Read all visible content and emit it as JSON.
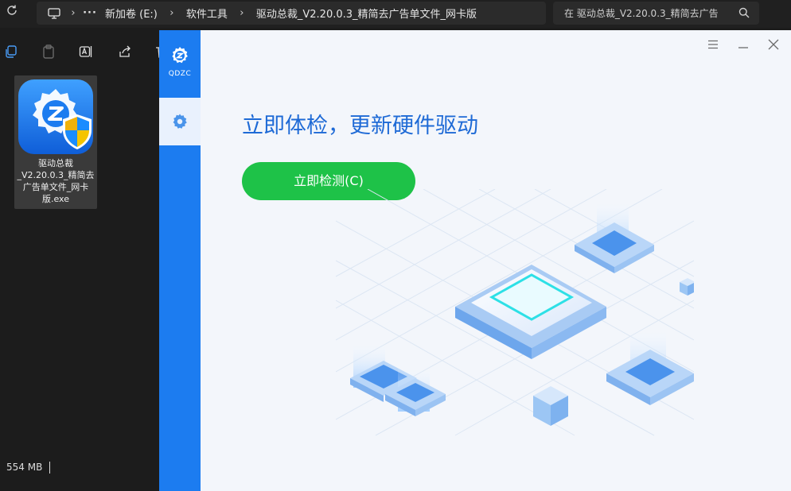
{
  "explorer": {
    "breadcrumbs": [
      "新加卷 (E:)",
      "软件工具",
      "驱动总裁_V2.20.0.3_精简去广告单文件_网卡版"
    ],
    "more_label": "···",
    "search_placeholder": "在 驱动总裁_V2.20.0.3_精简去广告",
    "file": {
      "name": "驱动总裁_V2.20.0.3_精简去广告单文件_网卡版.exe"
    },
    "status": {
      "size": "554 MB"
    }
  },
  "app": {
    "logo_text": "QDZC",
    "headline": "立即体检，更新硬件驱动",
    "scan_button": "立即检测(C)",
    "accent": "#1c7cf0",
    "button_color": "#1ec248"
  }
}
